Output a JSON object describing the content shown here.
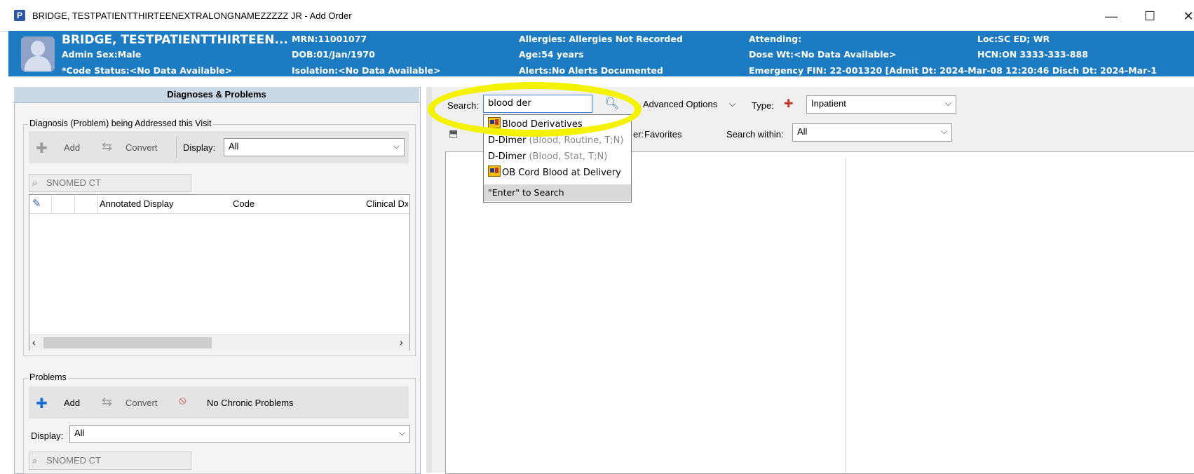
{
  "window": {
    "app_letter": "P",
    "title": "BRIDGE, TESTPATIENTTHIRTEENEXTRALONGNAMEZZZZZ JR - Add Order",
    "min": "—",
    "max": "☐",
    "close": "✕"
  },
  "banner": {
    "name": "BRIDGE, TESTPATIENTTHIRTEEN...",
    "admin_sex": "Admin Sex:Male",
    "code_status": "*Code Status:<No Data Available>",
    "mrn": "MRN:11001077",
    "dob": "DOB:01/Jan/1970",
    "isolation": "Isolation:<No Data Available>",
    "allergies": "Allergies: Allergies Not Recorded",
    "age": "Age:54 years",
    "alerts": "Alerts:No Alerts Documented",
    "attending": "Attending:",
    "dose_wt": "Dose Wt:<No Data Available>",
    "fin": "Emergency FIN: 22-001320 [Admit Dt: 2024-Mar-08 12:20:46 Disch Dt: 2024-Mar-1",
    "loc": "Loc:SC ED; WR",
    "hcn": "HCN:ON 3333-333-888"
  },
  "left_panel": {
    "header": "Diagnoses & Problems",
    "diagnosis_group": {
      "legend": "Diagnosis (Problem) being Addressed this Visit",
      "add": "Add",
      "convert": "Convert",
      "display_label": "Display:",
      "display_value": "All",
      "snomed_tab": "SNOMED CT",
      "columns": [
        "Annotated Display",
        "Code",
        "Clinical Dx"
      ]
    },
    "problems_group": {
      "legend": "Problems",
      "add": "Add",
      "convert": "Convert",
      "no_chronic": "No Chronic Problems",
      "display_label": "Display:",
      "display_value": "All",
      "snomed_tab": "SNOMED CT"
    }
  },
  "search": {
    "label": "Search:",
    "value": "blood der",
    "advanced_options": "Advanced Options",
    "type_label": "Type:",
    "type_value": "Inpatient",
    "folder_label": "er:",
    "folder_value": "Favorites",
    "search_within_label": "Search within:",
    "search_within_value": "All"
  },
  "autocomplete": {
    "items": [
      {
        "name": "Blood Derivatives",
        "detail": "",
        "icon": "order-set-icon"
      },
      {
        "name": "D-Dimer",
        "detail": " (Blood, Routine, T;N)",
        "icon": ""
      },
      {
        "name": "D-Dimer",
        "detail": " (Blood, Stat, T;N)",
        "icon": ""
      },
      {
        "name": "OB Cord Blood at Delivery",
        "detail": "",
        "icon": "order-set-icon"
      }
    ],
    "footer": "\"Enter\" to Search"
  },
  "colors": {
    "banner": "#1d7bc1",
    "highlight": "#f5f200",
    "panel_header": "#cbd8e6"
  }
}
